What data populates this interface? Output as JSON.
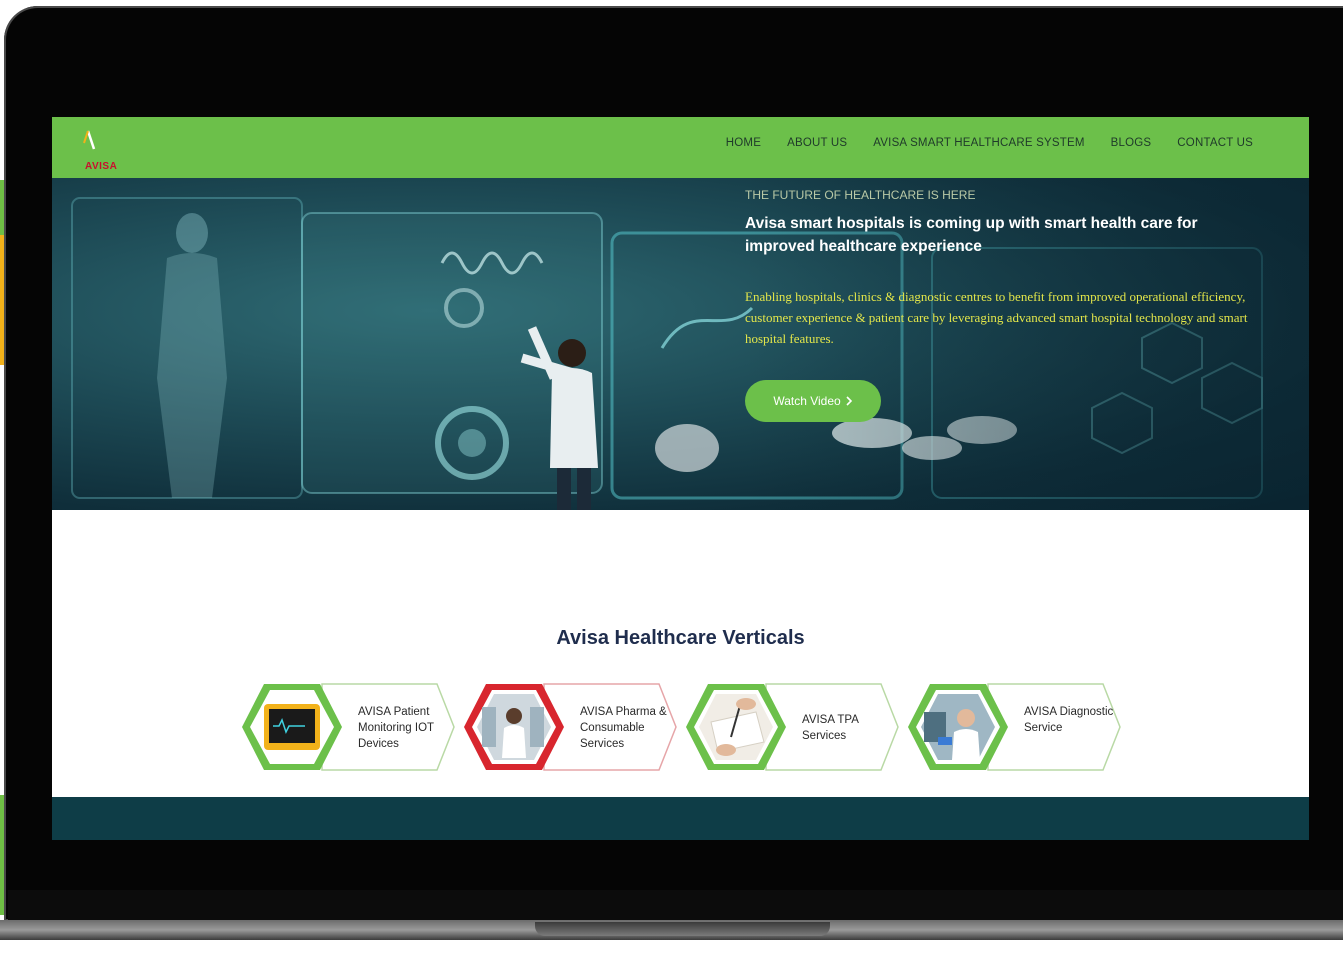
{
  "brand": {
    "logo_text": "AVISA"
  },
  "nav": {
    "items": [
      "HOME",
      "ABOUT US",
      "AVISA SMART HEALTHCARE SYSTEM",
      "BLOGS",
      "CONTACT US"
    ]
  },
  "hero": {
    "eyebrow": "THE FUTURE OF HEALTHCARE IS HERE",
    "title": "Avisa smart hospitals is coming up with smart health care for improved healthcare experience",
    "description": "Enabling hospitals, clinics & diagnostic centres to benefit from improved operational efficiency, customer experience & patient care by leveraging advanced smart hospital technology and smart hospital features.",
    "cta_label": "Watch Video",
    "cta_icon": "chevron-right-icon"
  },
  "verticals": {
    "title": "Avisa Healthcare Verticals",
    "items": [
      {
        "label": "AVISA Patient Monitoring IOT Devices",
        "accent": "#6cc04a",
        "icon": "patient-monitor-icon"
      },
      {
        "label": "AVISA Pharma & Consumable Services",
        "accent": "#d8262e",
        "icon": "pharmacist-icon"
      },
      {
        "label": "AVISA TPA Services",
        "accent": "#6cc04a",
        "icon": "handshake-document-icon"
      },
      {
        "label": "AVISA Diagnostic Service",
        "accent": "#6cc04a",
        "icon": "lab-scientist-icon"
      }
    ]
  },
  "colors": {
    "brand_green": "#6cc04a",
    "hero_text_yellow": "#e3e64a",
    "footer_teal": "#0e3d47",
    "heading_navy": "#1f2d4d"
  }
}
